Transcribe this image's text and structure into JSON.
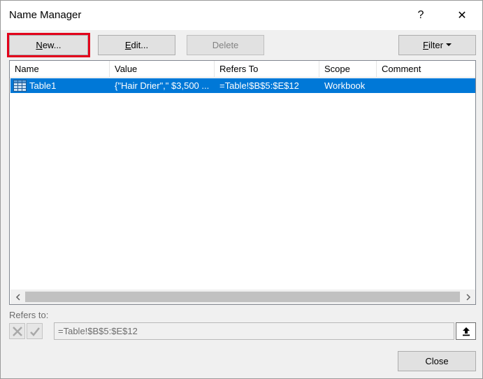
{
  "window": {
    "title": "Name Manager",
    "help_label": "?",
    "close_label": "✕"
  },
  "toolbar": {
    "new_mnemonic": "N",
    "new_rest": "ew...",
    "edit_mnemonic": "E",
    "edit_rest": "dit...",
    "delete_label": "Delete",
    "filter_mnemonic": "F",
    "filter_rest": "ilter"
  },
  "list": {
    "columns": [
      "Name",
      "Value",
      "Refers To",
      "Scope",
      "Comment"
    ],
    "rows": [
      {
        "name": "Table1",
        "value": "{\"Hair Drier\",\" $3,500 ...",
        "refers_to": "=Table!$B$5:$E$12",
        "scope": "Workbook",
        "comment": "",
        "icon": "table-icon"
      }
    ],
    "selected_color": "#0078d7"
  },
  "refers": {
    "label": "Refers to:",
    "value": "=Table!$B$5:$E$12"
  },
  "footer": {
    "close_label": "Close"
  },
  "colors": {
    "highlight_outline": "#e3001b",
    "selection": "#0078d7"
  }
}
